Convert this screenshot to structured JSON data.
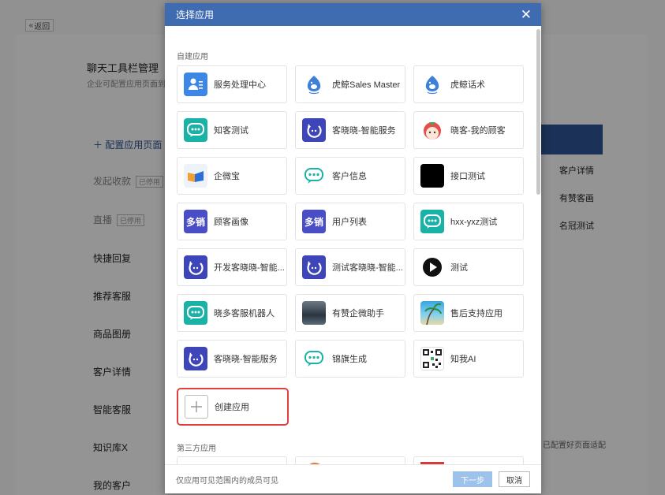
{
  "background": {
    "back_label": "返回",
    "title": "聊天工具栏管理",
    "subtitle": "企业可配置应用页面到",
    "config_link": "配置应用页面",
    "side_items": [
      {
        "label": "发起收款",
        "tag": "已停用"
      },
      {
        "label": "直播",
        "tag": "已停用"
      },
      {
        "label": "快捷回复",
        "tag": ""
      },
      {
        "label": "推荐客服",
        "tag": ""
      },
      {
        "label": "商品图册",
        "tag": ""
      },
      {
        "label": "客户详情",
        "tag": ""
      },
      {
        "label": "智能客服",
        "tag": ""
      },
      {
        "label": "知识库X",
        "tag": ""
      },
      {
        "label": "我的客户",
        "tag": ""
      }
    ],
    "right_items": [
      "客户详情",
      "有赞客画",
      "名冠测试"
    ],
    "right_note": "已配置好页面适配"
  },
  "modal": {
    "title": "选择应用",
    "section_custom": "自建应用",
    "section_third": "第三方应用",
    "apps": [
      {
        "name": "服务处理中心",
        "icon": "contact-card-icon"
      },
      {
        "name": "虎鲸Sales Master",
        "icon": "orca-icon"
      },
      {
        "name": "虎鲸话术",
        "icon": "orca-icon"
      },
      {
        "name": "知客测试",
        "icon": "chat-bot-icon"
      },
      {
        "name": "客晓晓-智能服务",
        "icon": "refresh-bot-icon"
      },
      {
        "name": "晓客-我的顾客",
        "icon": "tomato-face-icon"
      },
      {
        "name": "企微宝",
        "icon": "fold-icon"
      },
      {
        "name": "客户信息",
        "icon": "chat-bot-outline-icon"
      },
      {
        "name": "接口测试",
        "icon": "black-square-icon"
      },
      {
        "name": "顾客画像",
        "icon": "duoxiao-icon",
        "icon_text": "多销"
      },
      {
        "name": "用户列表",
        "icon": "duoxiao-icon",
        "icon_text": "多销"
      },
      {
        "name": "hxx-yxz测试",
        "icon": "chat-bot-icon"
      },
      {
        "name": "开发客晓晓-智能...",
        "icon": "refresh-bot-icon"
      },
      {
        "name": "测试客晓晓-智能...",
        "icon": "refresh-bot-icon"
      },
      {
        "name": "测试",
        "icon": "play-icon"
      },
      {
        "name": "晓多客服机器人",
        "icon": "chat-bot-icon"
      },
      {
        "name": "有赞企微助手",
        "icon": "storm-photo-icon"
      },
      {
        "name": "售后支持应用",
        "icon": "beach-photo-icon"
      },
      {
        "name": "客晓晓-智能服务",
        "icon": "refresh-bot-icon"
      },
      {
        "name": "锦旗生成",
        "icon": "chat-bot-outline-icon"
      },
      {
        "name": "知我AI",
        "icon": "qr-code-icon"
      }
    ],
    "create_label": "创建应用",
    "footer_note": "仅应用可见范围内的成员可见",
    "next_label": "下一步",
    "cancel_label": "取消"
  }
}
